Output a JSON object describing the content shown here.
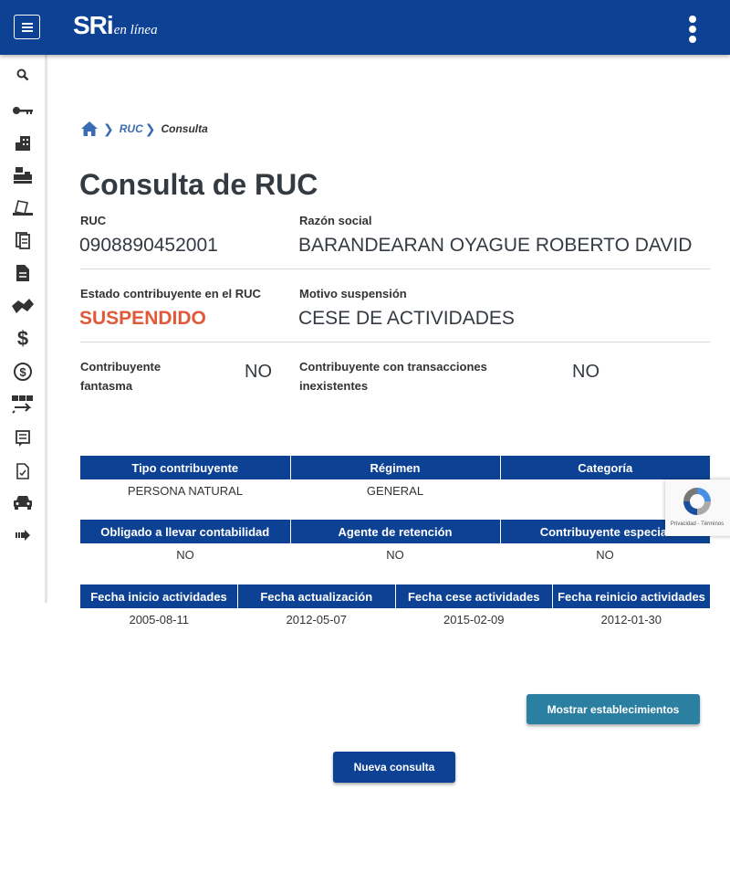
{
  "header": {
    "logo_main": "SRi",
    "logo_sub": "en línea",
    "menu_icon": "hamburger-icon",
    "kebab_icon": "more-vertical-icon"
  },
  "sidebar": {
    "items": [
      {
        "icon": "search-icon"
      },
      {
        "icon": "key-icon"
      },
      {
        "icon": "building-icon"
      },
      {
        "icon": "cash-register-icon"
      },
      {
        "icon": "laptop-document-icon"
      },
      {
        "icon": "documents-icon"
      },
      {
        "icon": "file-text-icon"
      },
      {
        "icon": "handshake-icon"
      },
      {
        "icon": "dollar-icon"
      },
      {
        "icon": "dollar-circle-icon"
      },
      {
        "icon": "transfer-icon"
      },
      {
        "icon": "form-icon"
      },
      {
        "icon": "checked-document-icon"
      },
      {
        "icon": "car-icon"
      },
      {
        "icon": "arrow-right-icon"
      }
    ]
  },
  "breadcrumb": {
    "home_icon": "home-icon",
    "link": "RUC",
    "current": "Consulta"
  },
  "page_title": "Consulta de RUC",
  "info": {
    "ruc_label": "RUC",
    "ruc_value": "0908890452001",
    "razon_label": "Razón social",
    "razon_value": "BARANDEARAN OYAGUE ROBERTO DAVID",
    "estado_label": "Estado contribuyente en el RUC",
    "estado_value": "SUSPENDIDO",
    "motivo_label": "Motivo suspensión",
    "motivo_value": "CESE DE ACTIVIDADES",
    "fantasma_label_1": "Contribuyente",
    "fantasma_label_2": "fantasma",
    "fantasma_value": "NO",
    "inexistentes_label_1": "Contribuyente con transacciones",
    "inexistentes_label_2": "inexistentes",
    "inexistentes_value": "NO"
  },
  "table1": {
    "headers": [
      "Tipo contribuyente",
      "Régimen",
      "Categoría"
    ],
    "row": [
      "PERSONA NATURAL",
      "GENERAL",
      ""
    ]
  },
  "table2": {
    "headers": [
      "Obligado a llevar contabilidad",
      "Agente de retención",
      "Contribuyente especial"
    ],
    "row": [
      "NO",
      "NO",
      "NO"
    ]
  },
  "table3": {
    "headers": [
      "Fecha inicio actividades",
      "Fecha actualización",
      "Fecha cese actividades",
      "Fecha reinicio actividades"
    ],
    "row": [
      "2005-08-11",
      "2012-05-07",
      "2015-02-09",
      "2012-01-30"
    ]
  },
  "buttons": {
    "mostrar": "Mostrar establecimientos",
    "nueva": "Nueva consulta"
  },
  "recaptcha": {
    "text": "Privacidad - Términos",
    "icon": "recaptcha-icon"
  },
  "colors": {
    "primary": "#0d4194",
    "accent_button": "#2b7fa0",
    "status_red": "#e05a3a"
  }
}
